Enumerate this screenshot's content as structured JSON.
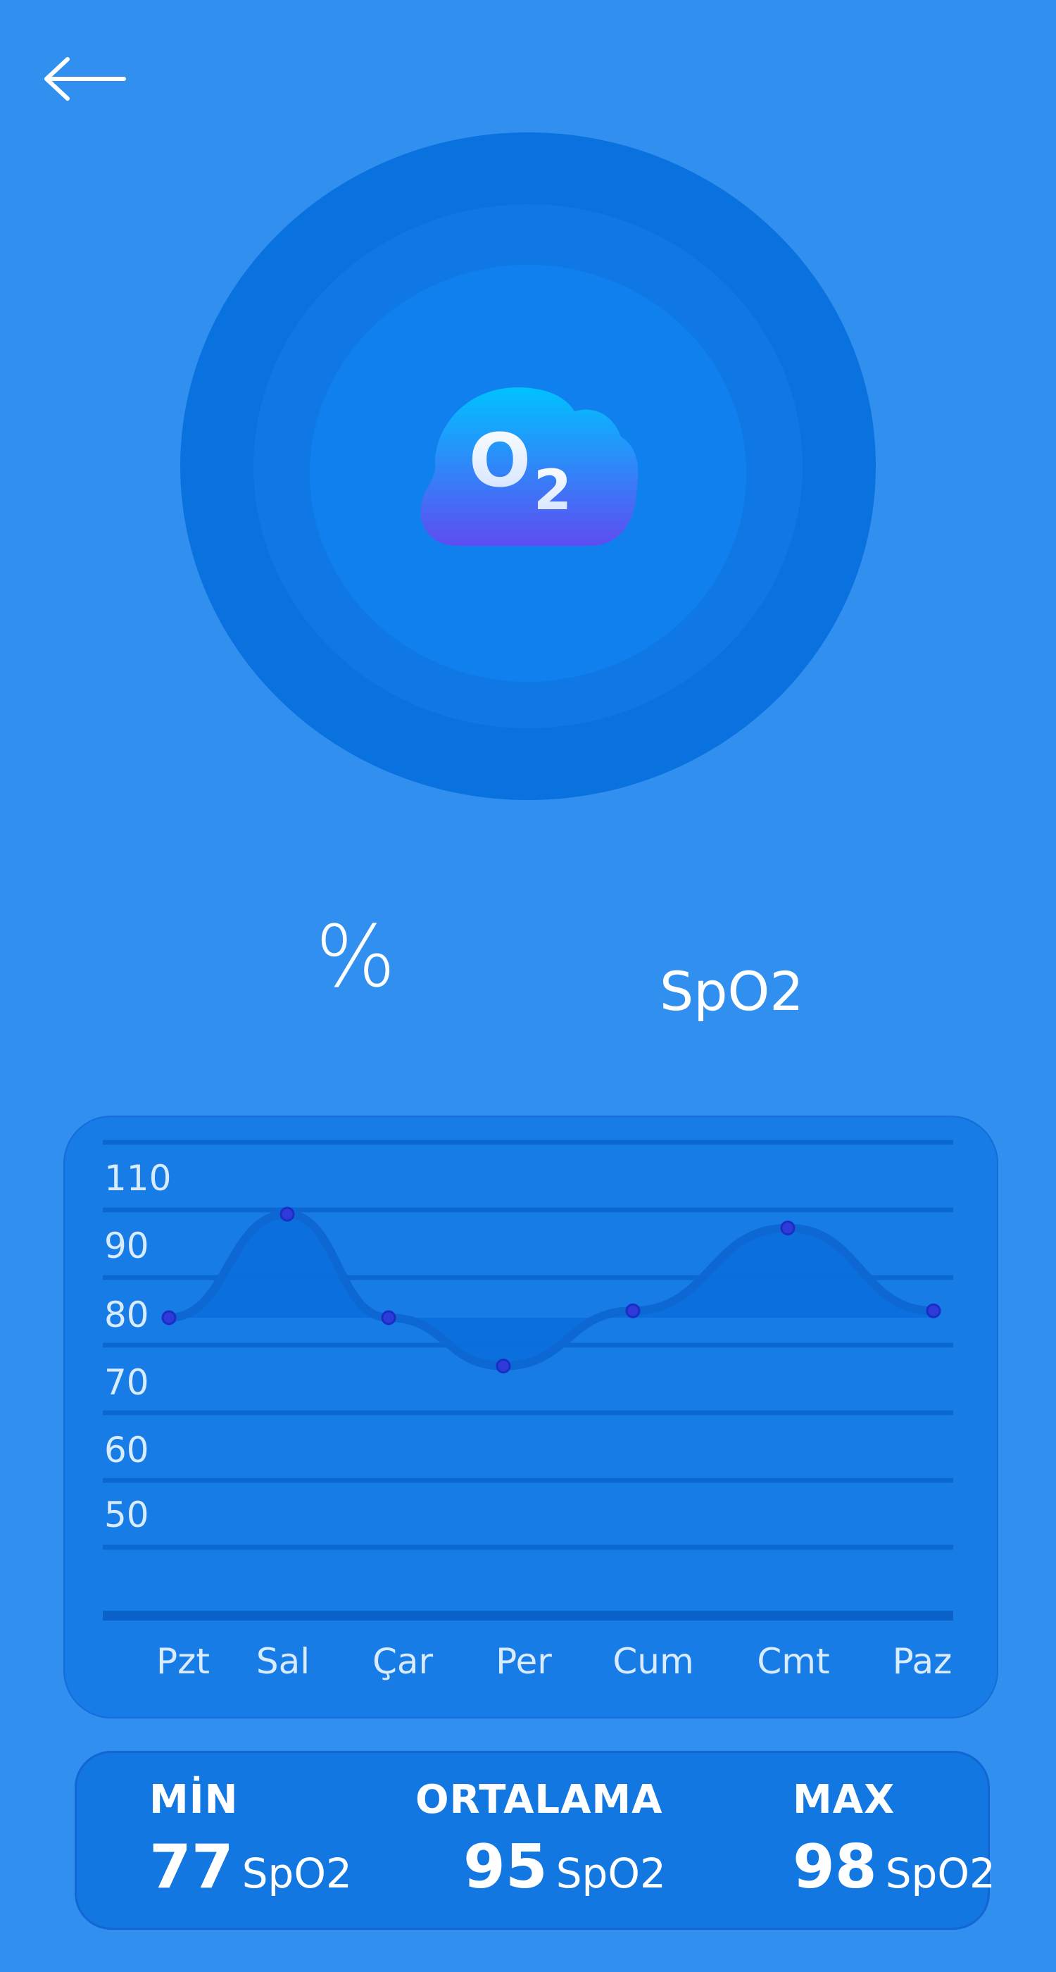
{
  "nav": {
    "back_icon": "arrow-left-icon"
  },
  "hero": {
    "icon": "o2-cloud-icon",
    "icon_text": "O2"
  },
  "reading": {
    "percent_sign": "%",
    "unit_label": "SpO2"
  },
  "colors": {
    "background": "#318ff0",
    "ring_outer": "#0a72df",
    "ring_middle": "#0f78e5",
    "ring_inner": "#1180ef",
    "card": "#177ce6",
    "grid_line": "#0b68d0",
    "area_fill": "#0a6fdc",
    "marker": "#2f3bd8"
  },
  "chart_data": {
    "type": "area",
    "categories": [
      "Pzt",
      "Sal",
      "Çar",
      "Per",
      "Cum",
      "Cmt",
      "Paz"
    ],
    "series": [
      {
        "values": [
          80,
          95,
          80,
          73,
          81,
          93,
          81
        ]
      }
    ],
    "baseline": 80,
    "y_tick_labels": [
      "110",
      "90",
      "80",
      "70",
      "60",
      "50"
    ],
    "ylim": [
      50,
      110
    ],
    "grid": true,
    "title": "",
    "xlabel": "",
    "ylabel": ""
  },
  "stats": {
    "min": {
      "label": "MİN",
      "value": "77",
      "unit": "SpO2"
    },
    "avg": {
      "label": "ORTALAMA",
      "value": "95",
      "unit": "SpO2"
    },
    "max": {
      "label": "MAX",
      "value": "98",
      "unit": "SpO2"
    }
  }
}
